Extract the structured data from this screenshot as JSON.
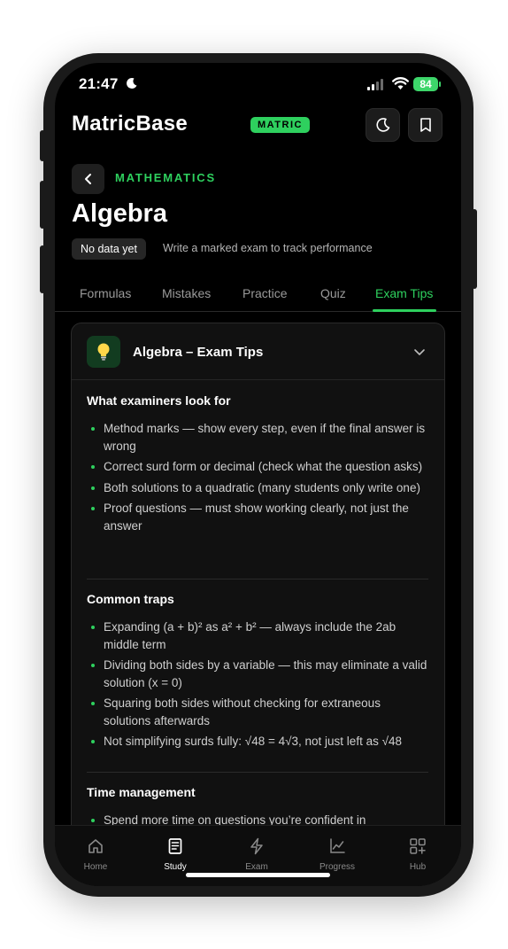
{
  "status": {
    "time": "21:47",
    "battery": "84"
  },
  "header": {
    "brand": "MatricBase",
    "badge": "MATRIC"
  },
  "topic": {
    "subject": "MATHEMATICS",
    "title": "Algebra",
    "badge": "No data yet",
    "hint": "Write a marked exam to track performance"
  },
  "tabs": [
    {
      "label": "Formulas"
    },
    {
      "label": "Mistakes"
    },
    {
      "label": "Practice"
    },
    {
      "label": "Quiz"
    },
    {
      "label": "Exam Tips"
    }
  ],
  "active_tab": "Exam Tips",
  "card": {
    "title": "Algebra – Exam Tips",
    "sections": [
      {
        "title": "What examiners look for",
        "items": [
          "Method marks — show every step, even if the final answer is wrong",
          "Correct surd form or decimal (check what the question asks)",
          "Both solutions to a quadratic (many students only write one)",
          "Proof questions — must show working clearly, not just the answer"
        ]
      },
      {
        "title": "Common traps",
        "items": [
          "Expanding (a + b)² as a² + b² — always include the 2ab middle term",
          "Dividing both sides by a variable — this may eliminate a valid solution (x = 0)",
          "Squaring both sides without checking for extraneous solutions afterwards",
          "Not simplifying surds fully: √48 = 4√3, not just left as √48"
        ]
      },
      {
        "title": "Time management",
        "items": [
          "Spend more time on questions you’re confident in"
        ]
      }
    ]
  },
  "nav": [
    {
      "label": "Home",
      "icon": "home-icon"
    },
    {
      "label": "Study",
      "icon": "book-icon"
    },
    {
      "label": "Exam",
      "icon": "lightning-icon"
    },
    {
      "label": "Progress",
      "icon": "chart-icon"
    },
    {
      "label": "Hub",
      "icon": "grid-plus-icon"
    }
  ],
  "active_nav": "Study",
  "colors": {
    "accent": "#2ed05e",
    "background": "#000000",
    "card": "#111111"
  }
}
